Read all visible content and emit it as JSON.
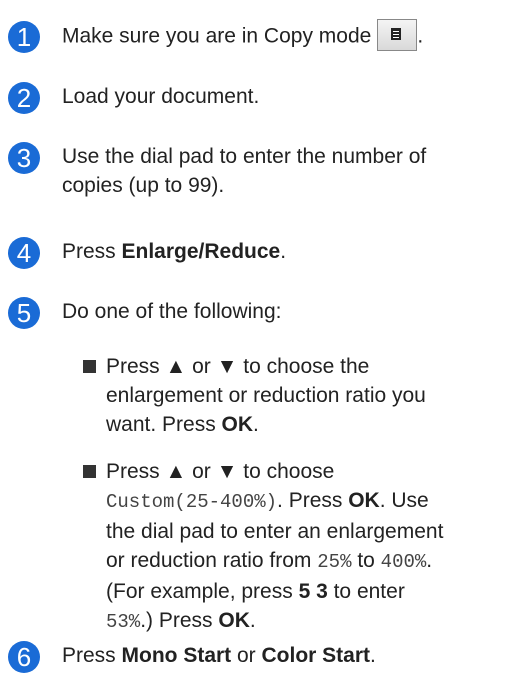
{
  "steps": [
    {
      "number": "1",
      "text": "Make sure you are in Copy mode",
      "suffix": "."
    },
    {
      "number": "2",
      "text": "Load your document."
    },
    {
      "number": "3",
      "line1": "Use the dial pad to enter the number of",
      "line2": "copies (up to 99)."
    },
    {
      "number": "4",
      "pre": "Press ",
      "bold": "Enlarge/Reduce",
      "post": "."
    },
    {
      "number": "5",
      "text": "Do one of the following:"
    },
    {
      "number": "6",
      "pre": "Press ",
      "bold1": "Mono Start",
      "mid": " or ",
      "bold2": "Color Start",
      "post": "."
    }
  ],
  "bullets": [
    {
      "l1_a": "Press ▲ or ▼ to choose the",
      "l2": "enlargement or reduction ratio you",
      "l3_a": "want. Press ",
      "l3_b": "OK",
      "l3_c": "."
    },
    {
      "l1": "Press ▲ or ▼ to choose",
      "l2_mono": "Custom(25-400%)",
      "l2_a": ". Press ",
      "l2_b": "OK",
      "l2_c": ". Use",
      "l3": "the dial pad to enter an enlargement",
      "l4_a": "or reduction ratio from ",
      "l4_m1": "25%",
      "l4_b": " to ",
      "l4_m2": "400%",
      "l4_c": ".",
      "l5_a": "(For example, press ",
      "l5_b": "5 3",
      "l5_c": " to enter",
      "l6_m": "53%",
      "l6_a": ".) Press ",
      "l6_b": "OK",
      "l6_c": "."
    }
  ],
  "colors": {
    "badge": "#1a6bd6"
  }
}
